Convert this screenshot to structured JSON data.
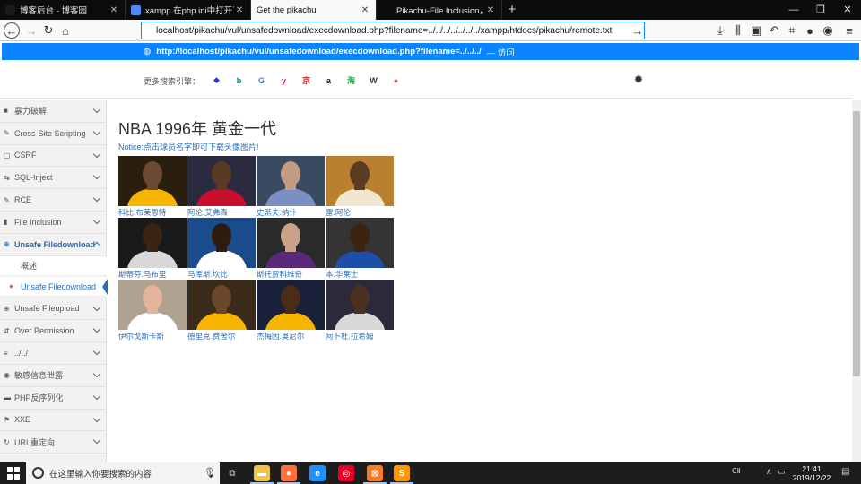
{
  "tabs": [
    {
      "label": "博客后台 - 博客园",
      "fav": "#1a1a1a",
      "active": false
    },
    {
      "label": "xampp 在php.ini中打开了两所",
      "fav": "#4c8bf5",
      "active": false
    },
    {
      "label": "Get the pikachu",
      "fav": "",
      "active": true
    },
    {
      "label": "Pikachu-File Inclusion，Unsafe",
      "fav": "#0c0c0d",
      "active": false
    }
  ],
  "address": {
    "url": "localhost/pikachu/vul/unsafedownload/execdownload.php?filename=../../../../../../../xampp/htdocs/pikachu/remote.txt"
  },
  "suggestion": {
    "url": "http://localhost/pikachu/vul/unsafedownload/execdownload.php?filename=../../../",
    "visit": "— 访问"
  },
  "engines": {
    "label": "更多搜索引擎：",
    "icons": [
      {
        "name": "baidu-icon",
        "glyph": "◆",
        "color": "#2932e1"
      },
      {
        "name": "bing-icon",
        "glyph": "b",
        "color": "#008373"
      },
      {
        "name": "google-icon",
        "glyph": "G",
        "color": "#4285f4"
      },
      {
        "name": "yahoo-icon",
        "glyph": "y",
        "color": "#e0203e"
      },
      {
        "name": "jd-icon",
        "glyph": "京",
        "color": "#e1251b"
      },
      {
        "name": "amazon-icon",
        "glyph": "a",
        "color": "#111111"
      },
      {
        "name": "taobao-icon",
        "glyph": "淘",
        "color": "#2aa34a"
      },
      {
        "name": "wikipedia-icon",
        "glyph": "W",
        "color": "#333333"
      },
      {
        "name": "duckduckgo-icon",
        "glyph": "●",
        "color": "#de5833"
      }
    ]
  },
  "sidebar": {
    "items": [
      {
        "label": "暴力破解",
        "icon": "lock-icon",
        "glyph": "■",
        "open": false
      },
      {
        "label": "Cross-Site Scripting",
        "icon": "xss-icon",
        "glyph": "✎",
        "open": false
      },
      {
        "label": "CSRF",
        "icon": "csrf-icon",
        "glyph": "▢",
        "open": false
      },
      {
        "label": "SQL-Inject",
        "icon": "sql-icon",
        "glyph": "↹",
        "open": false
      },
      {
        "label": "RCE",
        "icon": "wrench-icon",
        "glyph": "✎",
        "open": false
      },
      {
        "label": "File Inclusion",
        "icon": "file-icon",
        "glyph": "▮",
        "open": false
      },
      {
        "label": "Unsafe Filedownload",
        "icon": "download-icon",
        "glyph": "⊕",
        "open": true
      },
      {
        "label": "Unsafe Fileupload",
        "icon": "upload-icon",
        "glyph": "⊕",
        "open": false
      },
      {
        "label": "Over Permission",
        "icon": "permission-icon",
        "glyph": "⇵",
        "open": false
      },
      {
        "label": "../../",
        "icon": "dir-icon",
        "glyph": "≡",
        "open": false
      },
      {
        "label": "敏感信息泄露",
        "icon": "eye-icon",
        "glyph": "◉",
        "open": false
      },
      {
        "label": "PHP反序列化",
        "icon": "php-icon",
        "glyph": "▬",
        "open": false
      },
      {
        "label": "XXE",
        "icon": "flag-icon",
        "glyph": "⚑",
        "open": false
      },
      {
        "label": "URL重定向",
        "icon": "redirect-icon",
        "glyph": "↻",
        "open": false
      }
    ],
    "subs": [
      {
        "label": "概述",
        "current": false
      },
      {
        "label": "Unsafe Filedownload",
        "current": true
      }
    ]
  },
  "main": {
    "title": "NBA 1996年 黄金一代",
    "notice": "Notice:点击球员名字即可下载头像图片!"
  },
  "players": [
    {
      "name": "科比.布莱恩特",
      "jersey": "#f7b500",
      "bg": "#2a1f0e",
      "skin": "#6b4a2f"
    },
    {
      "name": "阿伦.艾弗森",
      "jersey": "#c8102e",
      "bg": "#2b2b40",
      "skin": "#5a3a24"
    },
    {
      "name": "史蒂夫.纳什",
      "jersey": "#7a8fc2",
      "bg": "#3a4a60",
      "skin": "#c49a80"
    },
    {
      "name": "雷.阿伦",
      "jersey": "#f2e6d0",
      "bg": "#b9812f",
      "skin": "#5b3b22"
    },
    {
      "name": "斯蒂芬.马布里",
      "jersey": "#d8d8d8",
      "bg": "#1a1a1a",
      "skin": "#3a2514"
    },
    {
      "name": "马库斯.坎比",
      "jersey": "#ffffff",
      "bg": "#1b4b8a",
      "skin": "#2e1c10"
    },
    {
      "name": "斯托贾科维奇",
      "jersey": "#5a2a7a",
      "bg": "#2a2a2a",
      "skin": "#c9a088"
    },
    {
      "name": "本.华莱士",
      "jersey": "#1e4fa8",
      "bg": "#343434",
      "skin": "#3a2414"
    },
    {
      "name": "伊尔戈斯卡斯",
      "jersey": "#ffffff",
      "bg": "#b0a290",
      "skin": "#e2b49a"
    },
    {
      "name": "德里克.费舍尔",
      "jersey": "#f7b500",
      "bg": "#3a2a1a",
      "skin": "#6a462a"
    },
    {
      "name": "杰梅因.奥尼尔",
      "jersey": "#f7b500",
      "bg": "#18203a",
      "skin": "#4a2c18"
    },
    {
      "name": "阿卜杜.拉希姆",
      "jersey": "#d8d8d8",
      "bg": "#2a2a3a",
      "skin": "#4a3020"
    }
  ],
  "taskbar": {
    "search_placeholder": "在这里输入你要搜索的内容",
    "time": "21:41",
    "date": "2019/12/22",
    "apps": [
      {
        "name": "file-explorer-icon",
        "color": "#f2c443",
        "glyph": "▬"
      },
      {
        "name": "firefox-icon",
        "color": "#ff7139",
        "glyph": "●"
      },
      {
        "name": "edge-icon",
        "color": "#1e90ff",
        "glyph": "e"
      },
      {
        "name": "netease-music-icon",
        "color": "#e60026",
        "glyph": "◎"
      },
      {
        "name": "xampp-icon",
        "color": "#fb7a24",
        "glyph": "⊠"
      },
      {
        "name": "sublime-icon",
        "color": "#ff9800",
        "glyph": "S"
      }
    ]
  }
}
